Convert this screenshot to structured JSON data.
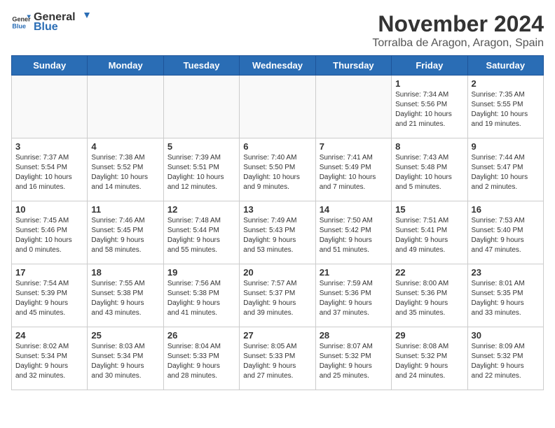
{
  "logo": {
    "general": "General",
    "blue": "Blue"
  },
  "header": {
    "month": "November 2024",
    "location": "Torralba de Aragon, Aragon, Spain"
  },
  "weekdays": [
    "Sunday",
    "Monday",
    "Tuesday",
    "Wednesday",
    "Thursday",
    "Friday",
    "Saturday"
  ],
  "weeks": [
    [
      {
        "day": "",
        "info": ""
      },
      {
        "day": "",
        "info": ""
      },
      {
        "day": "",
        "info": ""
      },
      {
        "day": "",
        "info": ""
      },
      {
        "day": "",
        "info": ""
      },
      {
        "day": "1",
        "info": "Sunrise: 7:34 AM\nSunset: 5:56 PM\nDaylight: 10 hours\nand 21 minutes."
      },
      {
        "day": "2",
        "info": "Sunrise: 7:35 AM\nSunset: 5:55 PM\nDaylight: 10 hours\nand 19 minutes."
      }
    ],
    [
      {
        "day": "3",
        "info": "Sunrise: 7:37 AM\nSunset: 5:54 PM\nDaylight: 10 hours\nand 16 minutes."
      },
      {
        "day": "4",
        "info": "Sunrise: 7:38 AM\nSunset: 5:52 PM\nDaylight: 10 hours\nand 14 minutes."
      },
      {
        "day": "5",
        "info": "Sunrise: 7:39 AM\nSunset: 5:51 PM\nDaylight: 10 hours\nand 12 minutes."
      },
      {
        "day": "6",
        "info": "Sunrise: 7:40 AM\nSunset: 5:50 PM\nDaylight: 10 hours\nand 9 minutes."
      },
      {
        "day": "7",
        "info": "Sunrise: 7:41 AM\nSunset: 5:49 PM\nDaylight: 10 hours\nand 7 minutes."
      },
      {
        "day": "8",
        "info": "Sunrise: 7:43 AM\nSunset: 5:48 PM\nDaylight: 10 hours\nand 5 minutes."
      },
      {
        "day": "9",
        "info": "Sunrise: 7:44 AM\nSunset: 5:47 PM\nDaylight: 10 hours\nand 2 minutes."
      }
    ],
    [
      {
        "day": "10",
        "info": "Sunrise: 7:45 AM\nSunset: 5:46 PM\nDaylight: 10 hours\nand 0 minutes."
      },
      {
        "day": "11",
        "info": "Sunrise: 7:46 AM\nSunset: 5:45 PM\nDaylight: 9 hours\nand 58 minutes."
      },
      {
        "day": "12",
        "info": "Sunrise: 7:48 AM\nSunset: 5:44 PM\nDaylight: 9 hours\nand 55 minutes."
      },
      {
        "day": "13",
        "info": "Sunrise: 7:49 AM\nSunset: 5:43 PM\nDaylight: 9 hours\nand 53 minutes."
      },
      {
        "day": "14",
        "info": "Sunrise: 7:50 AM\nSunset: 5:42 PM\nDaylight: 9 hours\nand 51 minutes."
      },
      {
        "day": "15",
        "info": "Sunrise: 7:51 AM\nSunset: 5:41 PM\nDaylight: 9 hours\nand 49 minutes."
      },
      {
        "day": "16",
        "info": "Sunrise: 7:53 AM\nSunset: 5:40 PM\nDaylight: 9 hours\nand 47 minutes."
      }
    ],
    [
      {
        "day": "17",
        "info": "Sunrise: 7:54 AM\nSunset: 5:39 PM\nDaylight: 9 hours\nand 45 minutes."
      },
      {
        "day": "18",
        "info": "Sunrise: 7:55 AM\nSunset: 5:38 PM\nDaylight: 9 hours\nand 43 minutes."
      },
      {
        "day": "19",
        "info": "Sunrise: 7:56 AM\nSunset: 5:38 PM\nDaylight: 9 hours\nand 41 minutes."
      },
      {
        "day": "20",
        "info": "Sunrise: 7:57 AM\nSunset: 5:37 PM\nDaylight: 9 hours\nand 39 minutes."
      },
      {
        "day": "21",
        "info": "Sunrise: 7:59 AM\nSunset: 5:36 PM\nDaylight: 9 hours\nand 37 minutes."
      },
      {
        "day": "22",
        "info": "Sunrise: 8:00 AM\nSunset: 5:36 PM\nDaylight: 9 hours\nand 35 minutes."
      },
      {
        "day": "23",
        "info": "Sunrise: 8:01 AM\nSunset: 5:35 PM\nDaylight: 9 hours\nand 33 minutes."
      }
    ],
    [
      {
        "day": "24",
        "info": "Sunrise: 8:02 AM\nSunset: 5:34 PM\nDaylight: 9 hours\nand 32 minutes."
      },
      {
        "day": "25",
        "info": "Sunrise: 8:03 AM\nSunset: 5:34 PM\nDaylight: 9 hours\nand 30 minutes."
      },
      {
        "day": "26",
        "info": "Sunrise: 8:04 AM\nSunset: 5:33 PM\nDaylight: 9 hours\nand 28 minutes."
      },
      {
        "day": "27",
        "info": "Sunrise: 8:05 AM\nSunset: 5:33 PM\nDaylight: 9 hours\nand 27 minutes."
      },
      {
        "day": "28",
        "info": "Sunrise: 8:07 AM\nSunset: 5:32 PM\nDaylight: 9 hours\nand 25 minutes."
      },
      {
        "day": "29",
        "info": "Sunrise: 8:08 AM\nSunset: 5:32 PM\nDaylight: 9 hours\nand 24 minutes."
      },
      {
        "day": "30",
        "info": "Sunrise: 8:09 AM\nSunset: 5:32 PM\nDaylight: 9 hours\nand 22 minutes."
      }
    ]
  ]
}
